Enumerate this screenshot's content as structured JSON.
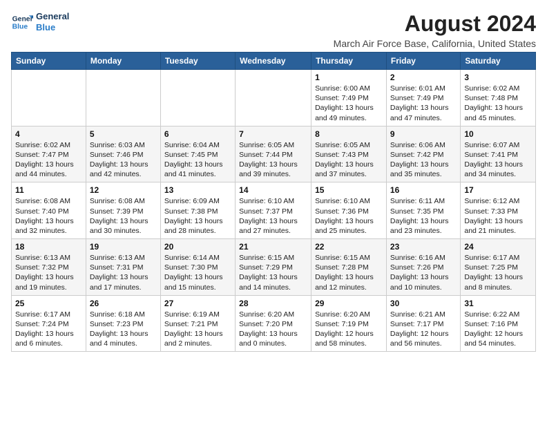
{
  "header": {
    "logo_line1": "General",
    "logo_line2": "Blue",
    "title": "August 2024",
    "subtitle": "March Air Force Base, California, United States"
  },
  "weekdays": [
    "Sunday",
    "Monday",
    "Tuesday",
    "Wednesday",
    "Thursday",
    "Friday",
    "Saturday"
  ],
  "weeks": [
    [
      {
        "day": "",
        "info": ""
      },
      {
        "day": "",
        "info": ""
      },
      {
        "day": "",
        "info": ""
      },
      {
        "day": "",
        "info": ""
      },
      {
        "day": "1",
        "info": "Sunrise: 6:00 AM\nSunset: 7:49 PM\nDaylight: 13 hours\nand 49 minutes."
      },
      {
        "day": "2",
        "info": "Sunrise: 6:01 AM\nSunset: 7:49 PM\nDaylight: 13 hours\nand 47 minutes."
      },
      {
        "day": "3",
        "info": "Sunrise: 6:02 AM\nSunset: 7:48 PM\nDaylight: 13 hours\nand 45 minutes."
      }
    ],
    [
      {
        "day": "4",
        "info": "Sunrise: 6:02 AM\nSunset: 7:47 PM\nDaylight: 13 hours\nand 44 minutes."
      },
      {
        "day": "5",
        "info": "Sunrise: 6:03 AM\nSunset: 7:46 PM\nDaylight: 13 hours\nand 42 minutes."
      },
      {
        "day": "6",
        "info": "Sunrise: 6:04 AM\nSunset: 7:45 PM\nDaylight: 13 hours\nand 41 minutes."
      },
      {
        "day": "7",
        "info": "Sunrise: 6:05 AM\nSunset: 7:44 PM\nDaylight: 13 hours\nand 39 minutes."
      },
      {
        "day": "8",
        "info": "Sunrise: 6:05 AM\nSunset: 7:43 PM\nDaylight: 13 hours\nand 37 minutes."
      },
      {
        "day": "9",
        "info": "Sunrise: 6:06 AM\nSunset: 7:42 PM\nDaylight: 13 hours\nand 35 minutes."
      },
      {
        "day": "10",
        "info": "Sunrise: 6:07 AM\nSunset: 7:41 PM\nDaylight: 13 hours\nand 34 minutes."
      }
    ],
    [
      {
        "day": "11",
        "info": "Sunrise: 6:08 AM\nSunset: 7:40 PM\nDaylight: 13 hours\nand 32 minutes."
      },
      {
        "day": "12",
        "info": "Sunrise: 6:08 AM\nSunset: 7:39 PM\nDaylight: 13 hours\nand 30 minutes."
      },
      {
        "day": "13",
        "info": "Sunrise: 6:09 AM\nSunset: 7:38 PM\nDaylight: 13 hours\nand 28 minutes."
      },
      {
        "day": "14",
        "info": "Sunrise: 6:10 AM\nSunset: 7:37 PM\nDaylight: 13 hours\nand 27 minutes."
      },
      {
        "day": "15",
        "info": "Sunrise: 6:10 AM\nSunset: 7:36 PM\nDaylight: 13 hours\nand 25 minutes."
      },
      {
        "day": "16",
        "info": "Sunrise: 6:11 AM\nSunset: 7:35 PM\nDaylight: 13 hours\nand 23 minutes."
      },
      {
        "day": "17",
        "info": "Sunrise: 6:12 AM\nSunset: 7:33 PM\nDaylight: 13 hours\nand 21 minutes."
      }
    ],
    [
      {
        "day": "18",
        "info": "Sunrise: 6:13 AM\nSunset: 7:32 PM\nDaylight: 13 hours\nand 19 minutes."
      },
      {
        "day": "19",
        "info": "Sunrise: 6:13 AM\nSunset: 7:31 PM\nDaylight: 13 hours\nand 17 minutes."
      },
      {
        "day": "20",
        "info": "Sunrise: 6:14 AM\nSunset: 7:30 PM\nDaylight: 13 hours\nand 15 minutes."
      },
      {
        "day": "21",
        "info": "Sunrise: 6:15 AM\nSunset: 7:29 PM\nDaylight: 13 hours\nand 14 minutes."
      },
      {
        "day": "22",
        "info": "Sunrise: 6:15 AM\nSunset: 7:28 PM\nDaylight: 13 hours\nand 12 minutes."
      },
      {
        "day": "23",
        "info": "Sunrise: 6:16 AM\nSunset: 7:26 PM\nDaylight: 13 hours\nand 10 minutes."
      },
      {
        "day": "24",
        "info": "Sunrise: 6:17 AM\nSunset: 7:25 PM\nDaylight: 13 hours\nand 8 minutes."
      }
    ],
    [
      {
        "day": "25",
        "info": "Sunrise: 6:17 AM\nSunset: 7:24 PM\nDaylight: 13 hours\nand 6 minutes."
      },
      {
        "day": "26",
        "info": "Sunrise: 6:18 AM\nSunset: 7:23 PM\nDaylight: 13 hours\nand 4 minutes."
      },
      {
        "day": "27",
        "info": "Sunrise: 6:19 AM\nSunset: 7:21 PM\nDaylight: 13 hours\nand 2 minutes."
      },
      {
        "day": "28",
        "info": "Sunrise: 6:20 AM\nSunset: 7:20 PM\nDaylight: 13 hours\nand 0 minutes."
      },
      {
        "day": "29",
        "info": "Sunrise: 6:20 AM\nSunset: 7:19 PM\nDaylight: 12 hours\nand 58 minutes."
      },
      {
        "day": "30",
        "info": "Sunrise: 6:21 AM\nSunset: 7:17 PM\nDaylight: 12 hours\nand 56 minutes."
      },
      {
        "day": "31",
        "info": "Sunrise: 6:22 AM\nSunset: 7:16 PM\nDaylight: 12 hours\nand 54 minutes."
      }
    ]
  ]
}
